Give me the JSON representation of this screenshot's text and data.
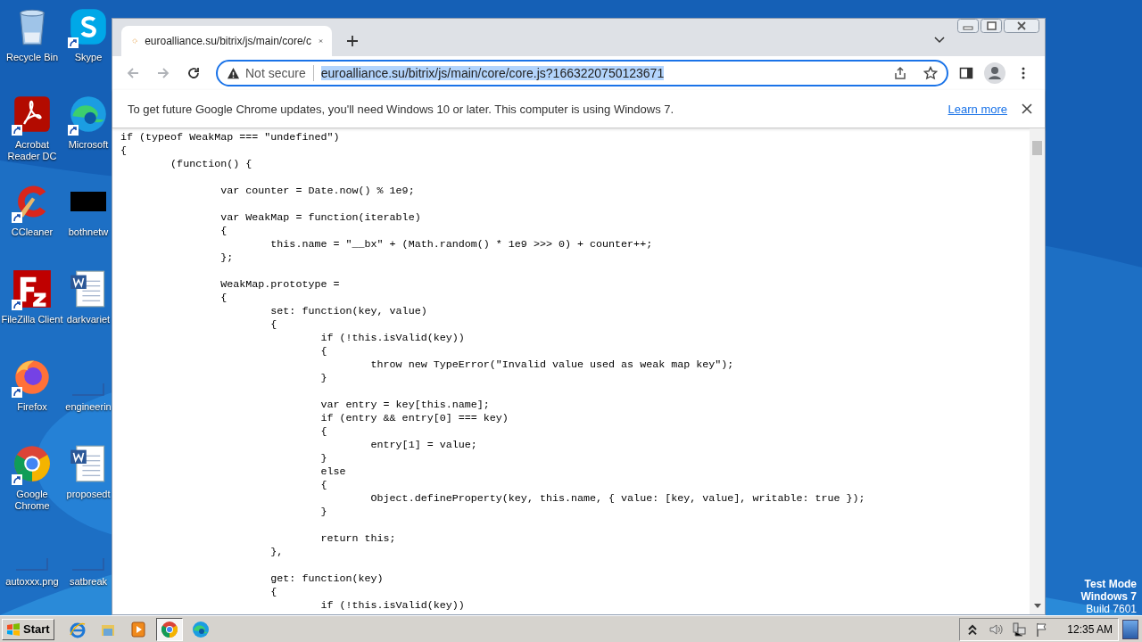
{
  "desktop": {
    "icon_columns": [
      [
        {
          "label": "Recycle Bin",
          "kind": "recycle-bin",
          "shortcut": false
        },
        {
          "label": "Acrobat Reader DC",
          "kind": "acrobat",
          "shortcut": true
        },
        {
          "label": "CCleaner",
          "kind": "ccleaner",
          "shortcut": true
        },
        {
          "label": "FileZilla Client",
          "kind": "filezilla",
          "shortcut": true
        },
        {
          "label": "Firefox",
          "kind": "firefox",
          "shortcut": true
        },
        {
          "label": "Google Chrome",
          "kind": "chrome",
          "shortcut": true
        },
        {
          "label": "autoxxx.png",
          "kind": "blank",
          "shortcut": false
        }
      ],
      [
        {
          "label": "Skype",
          "kind": "skype",
          "shortcut": true
        },
        {
          "label": "Microsoft",
          "kind": "edge",
          "shortcut": true
        },
        {
          "label": "bothnetw",
          "kind": "black",
          "shortcut": false
        },
        {
          "label": "darkvariet",
          "kind": "word",
          "shortcut": false
        },
        {
          "label": "engineerin",
          "kind": "blank",
          "shortcut": false
        },
        {
          "label": "proposedt",
          "kind": "word",
          "shortcut": false
        },
        {
          "label": "satbreak",
          "kind": "blank",
          "shortcut": false
        }
      ]
    ],
    "test_mode": [
      "Test Mode",
      "Windows 7",
      "Build 7601"
    ]
  },
  "browser": {
    "tab": {
      "title": "euroalliance.su/bitrix/js/main/core/c",
      "selected": true
    },
    "nav": [
      {
        "kind": "back",
        "disabled": true
      },
      {
        "kind": "forward",
        "disabled": true
      },
      {
        "kind": "reload",
        "disabled": false
      }
    ],
    "omnibox": {
      "security": "Not secure",
      "url": "euroalliance.su/bitrix/js/main/core/core.js?1663220750123671",
      "selected": true
    },
    "infobar": {
      "text": "To get future Google Chrome updates, you'll need Windows 10 or later. This computer is using Windows 7.",
      "link": "Learn more"
    },
    "code": [
      {
        "kind": "line",
        "text": "if (typeof WeakMap === \"undefined\")"
      },
      {
        "kind": "line",
        "text": "{"
      },
      {
        "kind": "line",
        "text": "\t(function() {"
      },
      {
        "kind": "blank"
      },
      {
        "kind": "line",
        "text": "\t\tvar counter = Date.now() % 1e9;"
      },
      {
        "kind": "blank"
      },
      {
        "kind": "line",
        "text": "\t\tvar WeakMap = function(iterable)"
      },
      {
        "kind": "line",
        "text": "\t\t{"
      },
      {
        "kind": "line",
        "text": "\t\t\tthis.name = \"__bx\" + (Math.random() * 1e9 >>> 0) + counter++;"
      },
      {
        "kind": "line",
        "text": "\t\t};"
      },
      {
        "kind": "blank"
      },
      {
        "kind": "line",
        "text": "\t\tWeakMap.prototype ="
      },
      {
        "kind": "line",
        "text": "\t\t{"
      },
      {
        "kind": "line",
        "text": "\t\t\tset: function(key, value)"
      },
      {
        "kind": "line",
        "text": "\t\t\t{"
      },
      {
        "kind": "line",
        "text": "\t\t\t\tif (!this.isValid(key))"
      },
      {
        "kind": "line",
        "text": "\t\t\t\t{"
      },
      {
        "kind": "line",
        "text": "\t\t\t\t\tthrow new TypeError(\"Invalid value used as weak map key\");"
      },
      {
        "kind": "line",
        "text": "\t\t\t\t}"
      },
      {
        "kind": "blank"
      },
      {
        "kind": "line",
        "text": "\t\t\t\tvar entry = key[this.name];"
      },
      {
        "kind": "line",
        "text": "\t\t\t\tif (entry && entry[0] === key)"
      },
      {
        "kind": "line",
        "text": "\t\t\t\t{"
      },
      {
        "kind": "line",
        "text": "\t\t\t\t\tentry[1] = value;"
      },
      {
        "kind": "line",
        "text": "\t\t\t\t}"
      },
      {
        "kind": "line",
        "text": "\t\t\t\telse"
      },
      {
        "kind": "line",
        "text": "\t\t\t\t{"
      },
      {
        "kind": "line",
        "text": "\t\t\t\t\tObject.defineProperty(key, this.name, { value: [key, value], writable: true });"
      },
      {
        "kind": "line",
        "text": "\t\t\t\t}"
      },
      {
        "kind": "blank"
      },
      {
        "kind": "line",
        "text": "\t\t\t\treturn this;"
      },
      {
        "kind": "line",
        "text": "\t\t\t},"
      },
      {
        "kind": "blank"
      },
      {
        "kind": "line",
        "text": "\t\t\tget: function(key)"
      },
      {
        "kind": "line",
        "text": "\t\t\t{"
      },
      {
        "kind": "line",
        "text": "\t\t\t\tif (!this.isValid(key))"
      }
    ]
  },
  "taskbar": {
    "start": "Start",
    "apps": [
      {
        "kind": "ie",
        "selected": false
      },
      {
        "kind": "explorer",
        "selected": false
      },
      {
        "kind": "media",
        "selected": false
      },
      {
        "kind": "chrome",
        "selected": true
      },
      {
        "kind": "edge",
        "selected": false
      }
    ],
    "tray": [
      {
        "kind": "chevron"
      },
      {
        "kind": "volume"
      },
      {
        "kind": "network"
      },
      {
        "kind": "flag"
      }
    ],
    "clock": "12:35 AM"
  }
}
